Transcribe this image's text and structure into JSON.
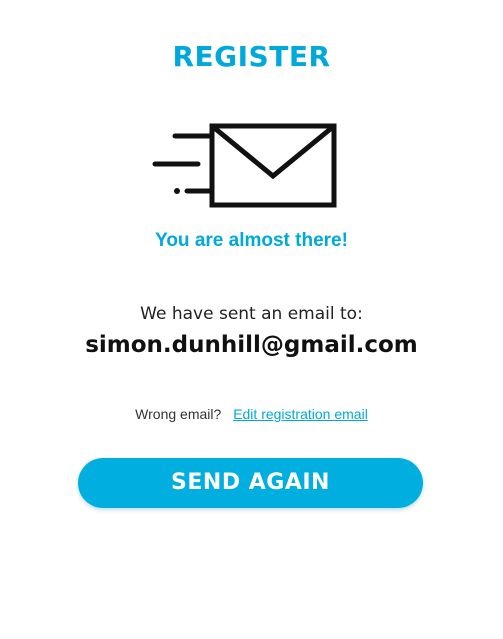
{
  "header": {
    "title": "REGISTER"
  },
  "illustration": {
    "icon": "envelope-icon"
  },
  "message": {
    "subtitle": "You are almost there!",
    "sent_to_label": "We have sent an email to:",
    "email": "simon.dunhill@gmail.com"
  },
  "wrong_email": {
    "label": "Wrong email?",
    "link_label": "Edit registration email"
  },
  "actions": {
    "send_again_label": "SEND AGAIN"
  },
  "colors": {
    "accent": "#00a9dc",
    "button": "#00aee0",
    "text": "#111111"
  }
}
